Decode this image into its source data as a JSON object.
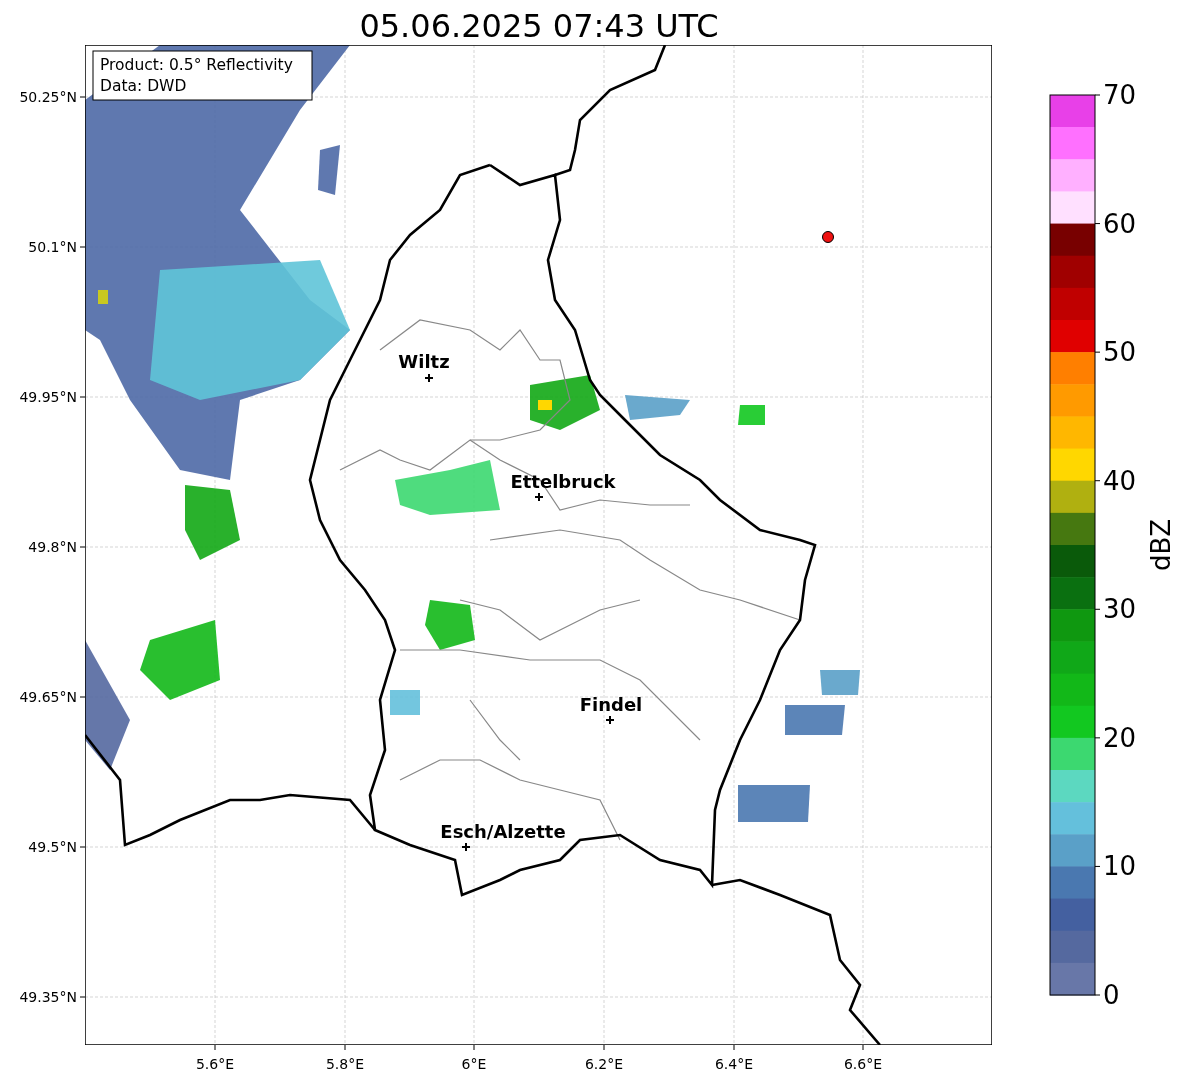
{
  "title": "05.06.2025 07:43 UTC",
  "info_box": [
    "Product: 0.5° Reflectivity",
    "Data: DWD"
  ],
  "lat_ticks": [
    "50.25°N",
    "50.1°N",
    "49.95°N",
    "49.8°N",
    "49.65°N",
    "49.5°N",
    "49.35°N"
  ],
  "lon_ticks": [
    "5.6°E",
    "5.8°E",
    "6°E",
    "6.2°E",
    "6.4°E",
    "6.6°E"
  ],
  "cities": [
    "Wiltz",
    "Ettelbruck",
    "Findel",
    "Esch/Alzette"
  ],
  "colorbar": {
    "label": "dBZ",
    "ticks": [
      "70",
      "60",
      "50",
      "40",
      "30",
      "20",
      "10",
      "0"
    ],
    "bins": [
      {
        "color": "#e840e8"
      },
      {
        "color": "#ff70ff"
      },
      {
        "color": "#ffb0ff"
      },
      {
        "color": "#ffe0ff"
      },
      {
        "color": "#780000"
      },
      {
        "color": "#a00000"
      },
      {
        "color": "#c00000"
      },
      {
        "color": "#e00000"
      },
      {
        "color": "#ff7f00"
      },
      {
        "color": "#ff9a00"
      },
      {
        "color": "#ffb700"
      },
      {
        "color": "#ffd700"
      },
      {
        "color": "#b0b010"
      },
      {
        "color": "#467810"
      },
      {
        "color": "#0a5a0a"
      },
      {
        "color": "#0a7010"
      },
      {
        "color": "#0f9810"
      },
      {
        "color": "#10a818"
      },
      {
        "color": "#12b818"
      },
      {
        "color": "#12c820"
      },
      {
        "color": "#3cd870"
      },
      {
        "color": "#5cd8c0"
      },
      {
        "color": "#64c0dc"
      },
      {
        "color": "#5aa0c8"
      },
      {
        "color": "#4a78b0"
      },
      {
        "color": "#4460a0"
      },
      {
        "color": "#55699f"
      },
      {
        "color": "#6877a8"
      }
    ]
  }
}
